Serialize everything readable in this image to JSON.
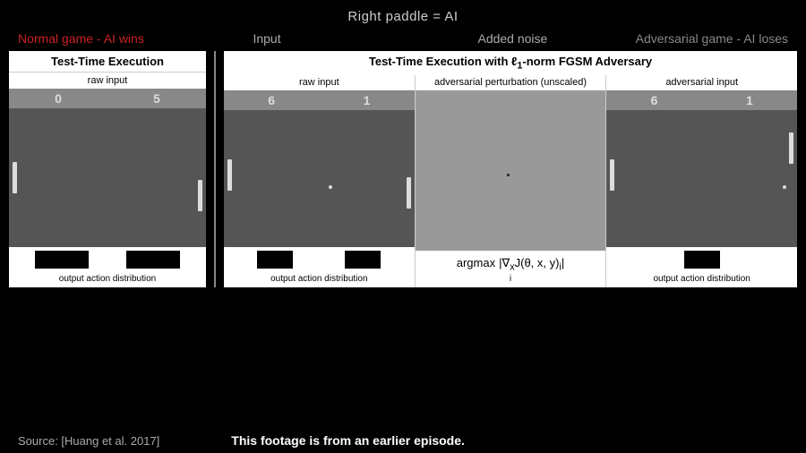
{
  "header": {
    "top_label": "Right paddle = AI"
  },
  "sections": {
    "normal_label": "Normal game - AI wins",
    "input_label": "Input",
    "noise_label": "Added noise",
    "adversarial_label": "Adversarial game - AI loses"
  },
  "left_panel": {
    "title": "Test-Time Execution",
    "sub_label": "raw input",
    "score_left": "0",
    "score_right": "5",
    "action_label": "output action distribution"
  },
  "right_panel": {
    "title": "Test-Time Execution with ℓ₁-norm FGSM Adversary",
    "col1_label": "raw input",
    "col1_score_l": "6",
    "col1_score_r": "1",
    "col1_action_label": "output action distribution",
    "col2_label": "adversarial perturbation (unscaled)",
    "col2_formula_main": "argmax",
    "col2_formula_var": "i",
    "col2_formula_body": "|∇ₓJ(θ, x, y)ᵢ|",
    "col3_label": "adversarial input",
    "col3_score_l": "6",
    "col3_score_r": "1",
    "col3_action_label": "output action distribution"
  },
  "footer": {
    "source": "Source: [Huang et al. 2017]",
    "episode_note": "This footage is from an earlier episode."
  }
}
